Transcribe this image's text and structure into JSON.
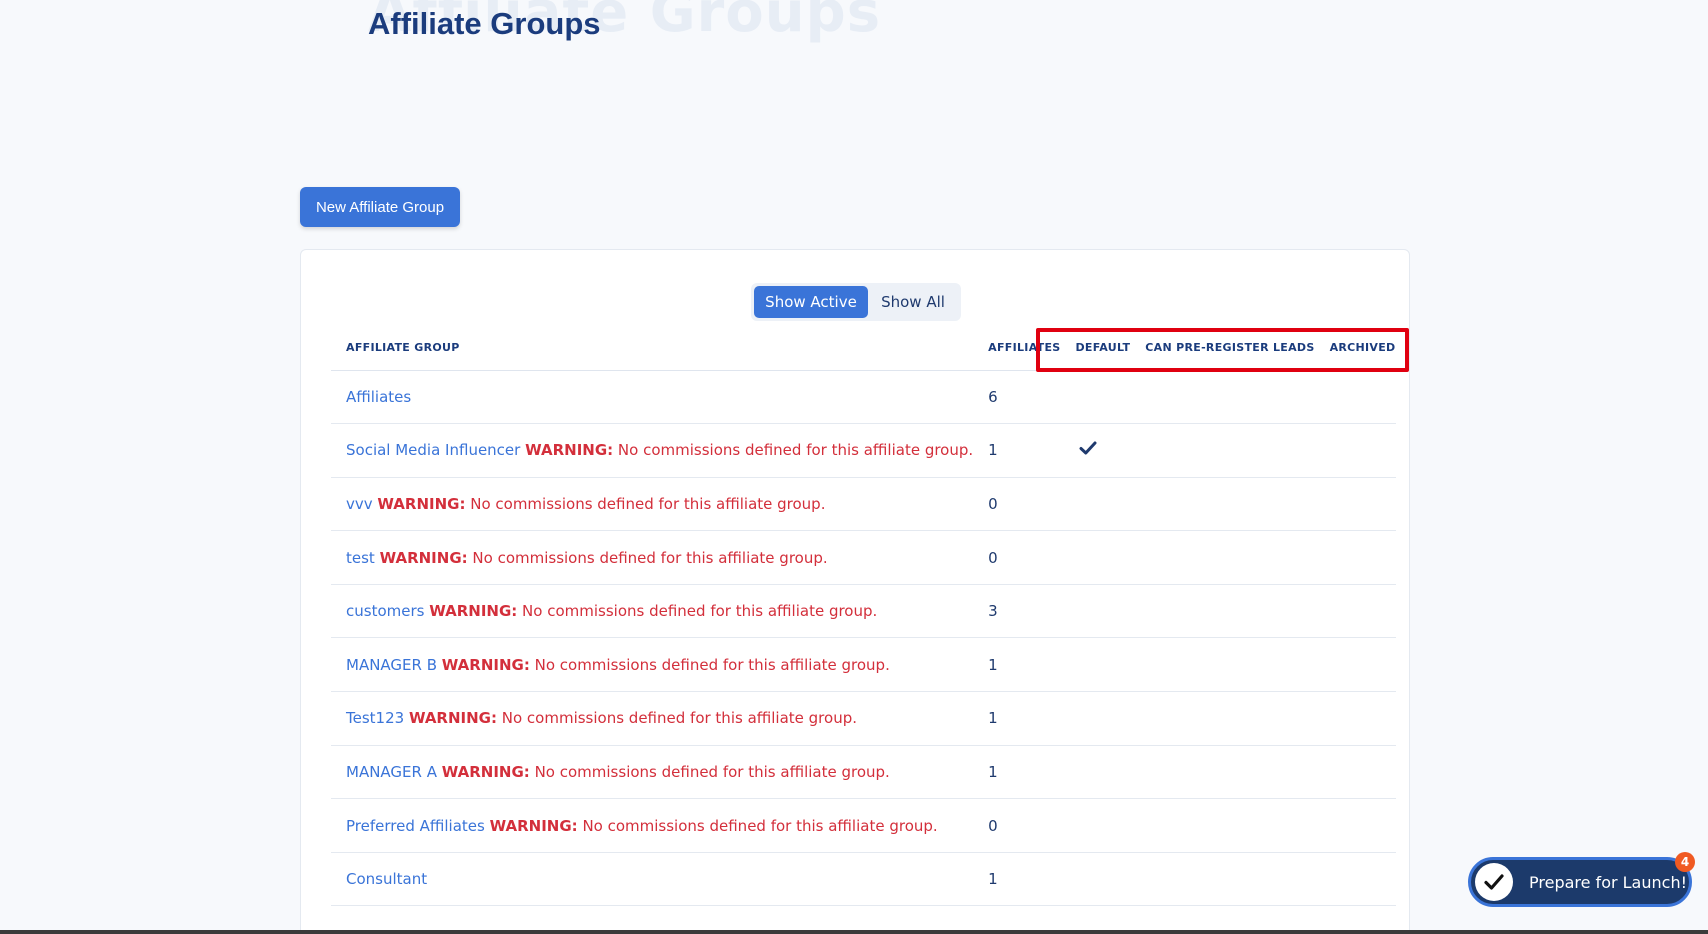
{
  "header": {
    "title": "Affiliate Groups",
    "title_ghost": "Affiliate Groups"
  },
  "toolbar": {
    "new_group_label": "New Affiliate Group"
  },
  "filter": {
    "show_active_label": "Show Active",
    "show_all_label": "Show All",
    "selected": "Show Active"
  },
  "table": {
    "columns": [
      "AFFILIATE GROUP",
      "AFFILIATES",
      "DEFAULT",
      "CAN PRE-REGISTER LEADS",
      "ARCHIVED"
    ],
    "warning_label": "WARNING:",
    "warning_text": "No commissions defined for this affiliate group.",
    "rows": [
      {
        "name": "Affiliates",
        "warning": false,
        "affiliates": "6",
        "default": false
      },
      {
        "name": "Social Media Influencer",
        "warning": true,
        "affiliates": "1",
        "default": true
      },
      {
        "name": "vvv",
        "warning": true,
        "affiliates": "0",
        "default": false
      },
      {
        "name": "test",
        "warning": true,
        "affiliates": "0",
        "default": false
      },
      {
        "name": "customers",
        "warning": true,
        "affiliates": "3",
        "default": false
      },
      {
        "name": "MANAGER B",
        "warning": true,
        "affiliates": "1",
        "default": false
      },
      {
        "name": "Test123",
        "warning": true,
        "affiliates": "1",
        "default": false
      },
      {
        "name": "MANAGER A",
        "warning": true,
        "affiliates": "1",
        "default": false
      },
      {
        "name": "Preferred Affiliates",
        "warning": true,
        "affiliates": "0",
        "default": false
      },
      {
        "name": "Consultant",
        "warning": false,
        "affiliates": "1",
        "default": false
      }
    ]
  },
  "launch_widget": {
    "label": "Prepare for Launch!",
    "badge_count": "4"
  },
  "colors": {
    "accent": "#3a74d8",
    "warning": "#d32f3b",
    "highlight": "#e00010",
    "launch_bg": "#1c3a6b"
  }
}
